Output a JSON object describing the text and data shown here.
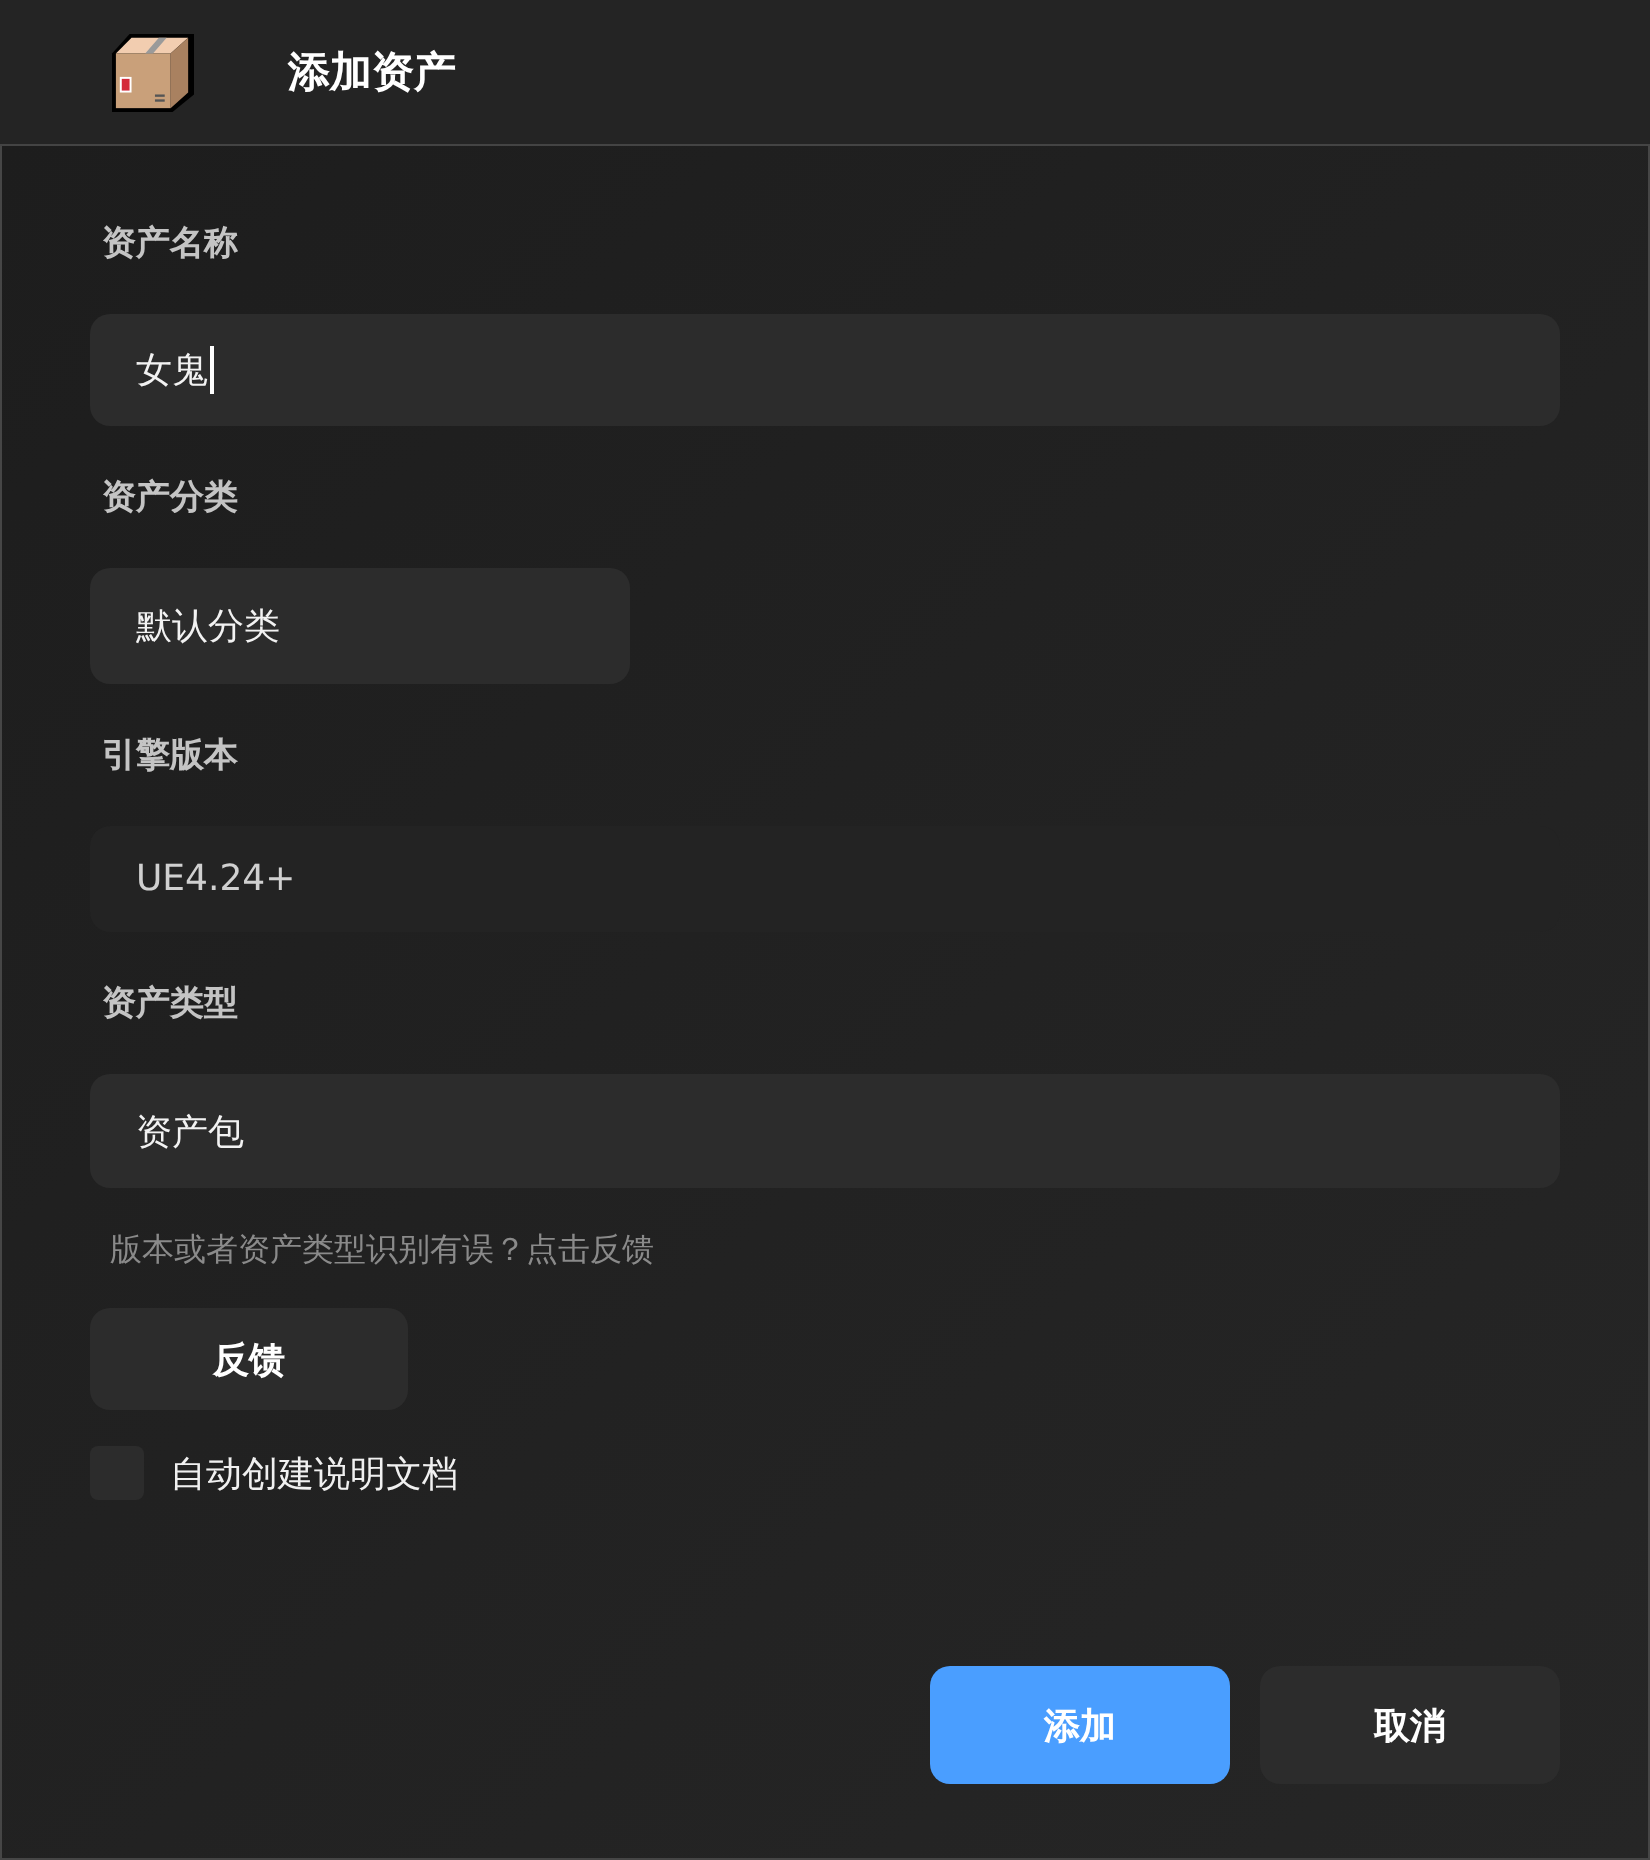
{
  "header": {
    "title": "添加资产"
  },
  "fields": [
    {
      "label": "资产名称",
      "value": "女鬼",
      "focused": true,
      "disabled": false
    },
    {
      "label": "资产分类",
      "value": "默认分类",
      "focused": false,
      "disabled": false
    },
    {
      "label": "引擎版本",
      "value": "UE4.24+",
      "focused": false,
      "disabled": true
    },
    {
      "label": "资产类型",
      "value": "资产包",
      "focused": false,
      "disabled": false
    }
  ],
  "hint": "版本或者资产类型识别有误？点击反馈",
  "feedback_button": "反馈",
  "auto_doc": {
    "label": "自动创建说明文档",
    "checked": false
  },
  "buttons": [
    {
      "label": "添加",
      "kind": "primary"
    },
    {
      "label": "取消",
      "kind": "secondary"
    }
  ]
}
